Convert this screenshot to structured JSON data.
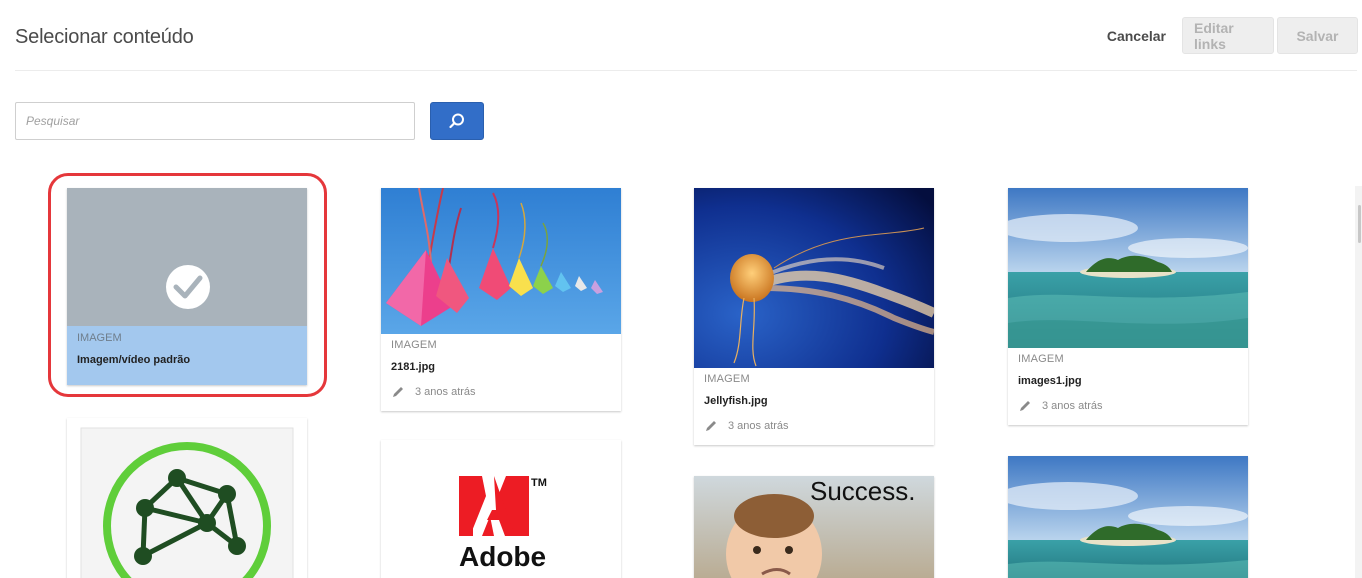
{
  "header": {
    "title": "Selecionar conteúdo",
    "cancel_label": "Cancelar",
    "edit_links_label": "Editar links",
    "save_label": "Salvar"
  },
  "search": {
    "placeholder": "Pesquisar",
    "value": "",
    "button_icon": "search-icon"
  },
  "assets": [
    {
      "type": "IMAGEM",
      "name": "Imagem/vídeo padrão",
      "modified": "",
      "selected": true,
      "icon": "checkmark-icon"
    },
    {
      "type": "IMAGEM",
      "name": "2181.jpg",
      "modified": "3 anos atrás",
      "selected": false
    },
    {
      "type": "IMAGEM",
      "name": "Jellyfish.jpg",
      "modified": "3 anos atrás",
      "selected": false
    },
    {
      "type": "IMAGEM",
      "name": "images1.jpg",
      "modified": "3 anos atrás",
      "selected": false
    },
    {
      "type": "",
      "name": "",
      "modified": "",
      "selected": false
    },
    {
      "type": "",
      "name": "",
      "modified": "",
      "selected": false,
      "logo_text": "Adobe",
      "logo_tm": "TM"
    },
    {
      "type": "",
      "name": "",
      "modified": "",
      "selected": false,
      "image_text": "Success."
    },
    {
      "type": "",
      "name": "",
      "modified": "",
      "selected": false
    }
  ],
  "colors": {
    "accent": "#326ec8",
    "selection_ring": "#e5373b",
    "selected_meta_bg": "#a3c8ee",
    "selected_thumb_bg": "#a9b3bb"
  }
}
